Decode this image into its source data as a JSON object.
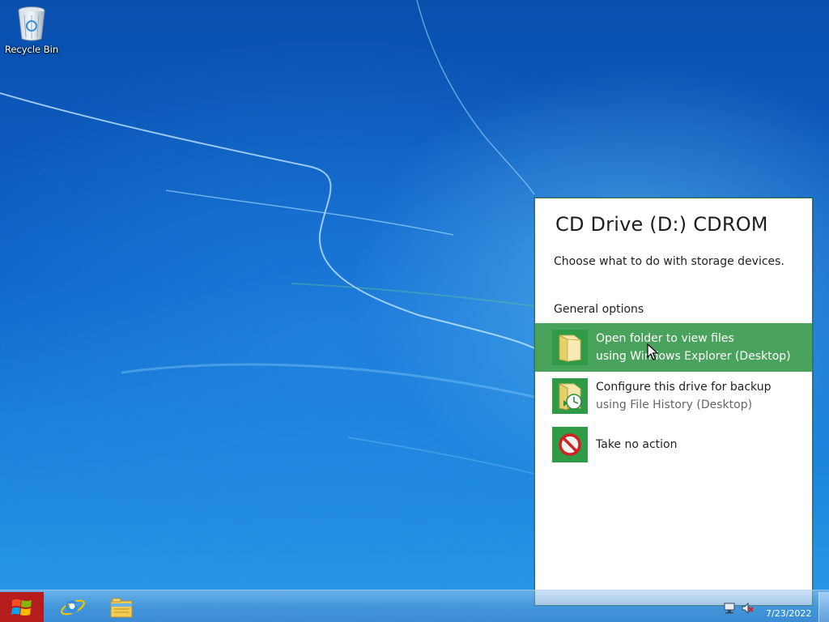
{
  "desktop": {
    "icons": [
      {
        "label": "Recycle Bin",
        "icon": "recycle-bin-icon"
      }
    ]
  },
  "autoplay": {
    "title": "CD Drive (D:) CDROM",
    "subtitle": "Choose what to do with storage devices.",
    "group_label": "General options",
    "options": [
      {
        "line1": "Open folder to view files",
        "line2": "using Windows Explorer (Desktop)",
        "icon": "folder-icon",
        "selected": true
      },
      {
        "line1": "Configure this drive for backup",
        "line2": "using File History (Desktop)",
        "icon": "file-history-icon",
        "selected": false
      },
      {
        "line1": "Take no action",
        "line2": "",
        "icon": "no-action-icon",
        "selected": false
      }
    ],
    "accent_color": "#4aa35c",
    "tile_color": "#2f9b46"
  },
  "taskbar": {
    "start_icon": "windows-logo-icon",
    "pinned": [
      {
        "name": "Internet Explorer",
        "icon": "internet-explorer-icon"
      },
      {
        "name": "File Explorer",
        "icon": "file-explorer-icon"
      }
    ],
    "tray_icons": [
      "network-icon",
      "volume-muted-icon"
    ],
    "clock": "7/23/2022"
  }
}
